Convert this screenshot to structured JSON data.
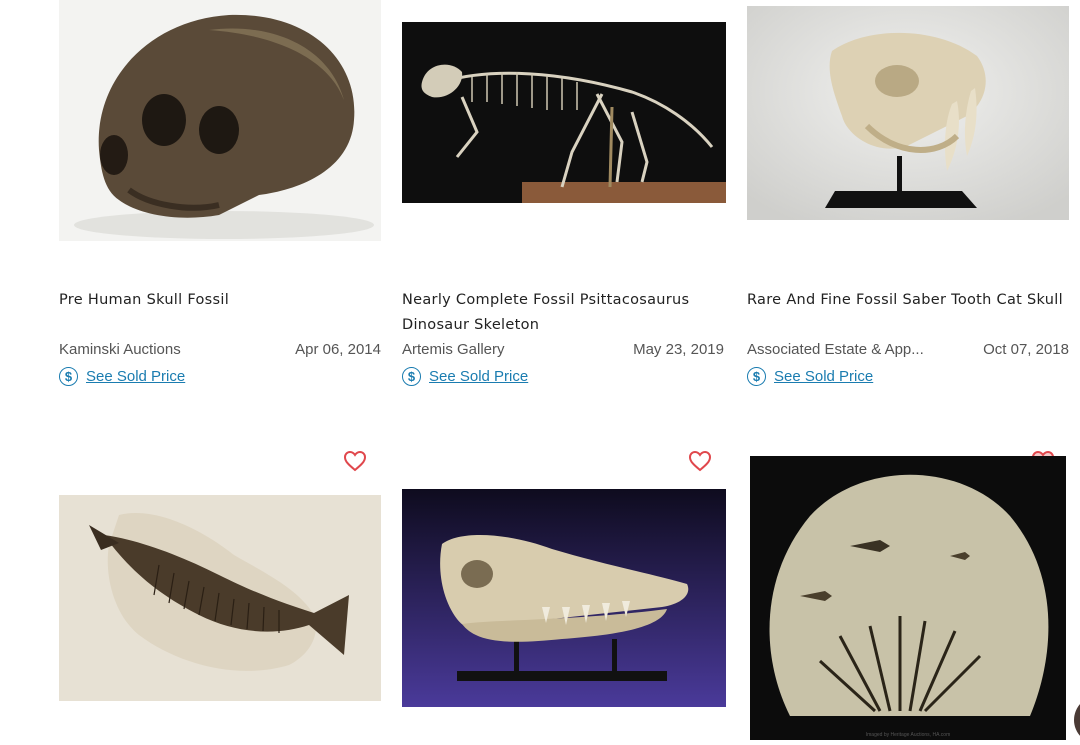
{
  "items": [
    {
      "title": "Pre Human Skull Fossil",
      "seller": "Kaminski Auctions",
      "date": "Apr 06, 2014",
      "sold_label": "See Sold Price",
      "image": "skull-fossil"
    },
    {
      "title": "Nearly Complete Fossil Psittacosaurus Dinosaur Skeleton",
      "seller": "Artemis Gallery",
      "date": "May 23, 2019",
      "sold_label": "See Sold Price",
      "image": "dinosaur-skeleton"
    },
    {
      "title": "Rare And Fine Fossil Saber Tooth Cat Skull",
      "seller": "Associated Estate & App...",
      "date": "Oct 07, 2018",
      "sold_label": "See Sold Price",
      "image": "saber-tooth-skull"
    },
    {
      "image": "fish-fossil"
    },
    {
      "image": "marine-reptile-skull"
    },
    {
      "image": "fish-palm-fossil-plate",
      "image_caption": "Imaged by Heritage Auctions, HA.com"
    }
  ],
  "icons": {
    "price": "dollar-circle-icon",
    "favorite": "heart-outline-icon"
  },
  "colors": {
    "link": "#1a7cb0",
    "heart": "#e0474c"
  }
}
